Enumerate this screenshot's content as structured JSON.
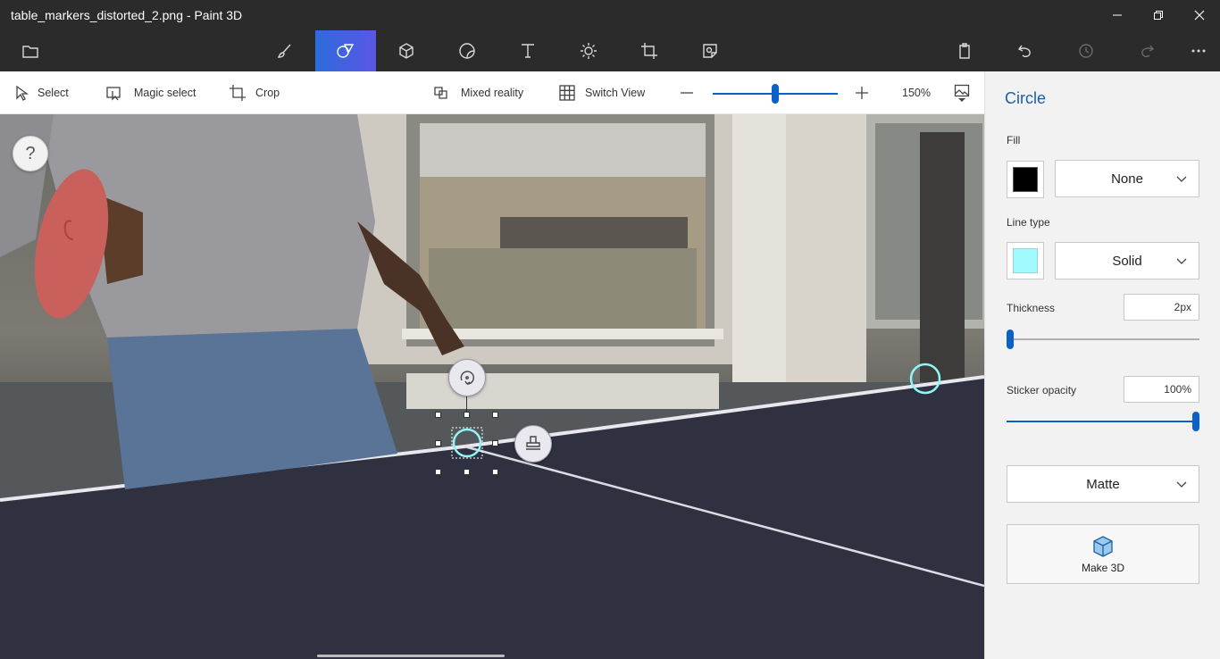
{
  "window": {
    "title": "table_markers_distorted_2.png - Paint 3D"
  },
  "ribbon": {
    "items": [
      {
        "name": "menu",
        "icon": "folder-icon"
      },
      {
        "name": "brushes",
        "icon": "brush-icon"
      },
      {
        "name": "2d-shapes",
        "icon": "shapes-icon",
        "active": true
      },
      {
        "name": "3d-shapes",
        "icon": "cube-icon"
      },
      {
        "name": "stickers",
        "icon": "sticker-icon"
      },
      {
        "name": "text",
        "icon": "text-icon"
      },
      {
        "name": "effects",
        "icon": "sun-icon"
      },
      {
        "name": "canvas",
        "icon": "canvas-icon"
      },
      {
        "name": "3d-library",
        "icon": "library-icon"
      }
    ],
    "right_items": [
      "paste-icon",
      "undo-icon",
      "history-icon",
      "redo-icon",
      "more-icon"
    ]
  },
  "toolbar": {
    "select_label": "Select",
    "magic_select_label": "Magic select",
    "crop_label": "Crop",
    "mixed_reality_label": "Mixed reality",
    "switch_view_label": "Switch View",
    "zoom_level": "150%",
    "zoom_fraction": 0.5
  },
  "canvas": {
    "help_label": "?"
  },
  "panel": {
    "title": "Circle",
    "fill_label": "Fill",
    "fill_color": "#000000",
    "fill_option": "None",
    "line_type_label": "Line type",
    "line_color": "#9ffbff",
    "line_option": "Solid",
    "thickness_label": "Thickness",
    "thickness_value": "2px",
    "thickness_fraction": 0.0,
    "opacity_label": "Sticker opacity",
    "opacity_value": "100%",
    "opacity_fraction": 1.0,
    "material_option": "Matte",
    "make3d_label": "Make 3D"
  },
  "colors": {
    "accent": "#0a62c9",
    "active_tab_start": "#2d6bdc",
    "active_tab_end": "#5a57e6",
    "marker_cyan": "#8ff5f5"
  }
}
